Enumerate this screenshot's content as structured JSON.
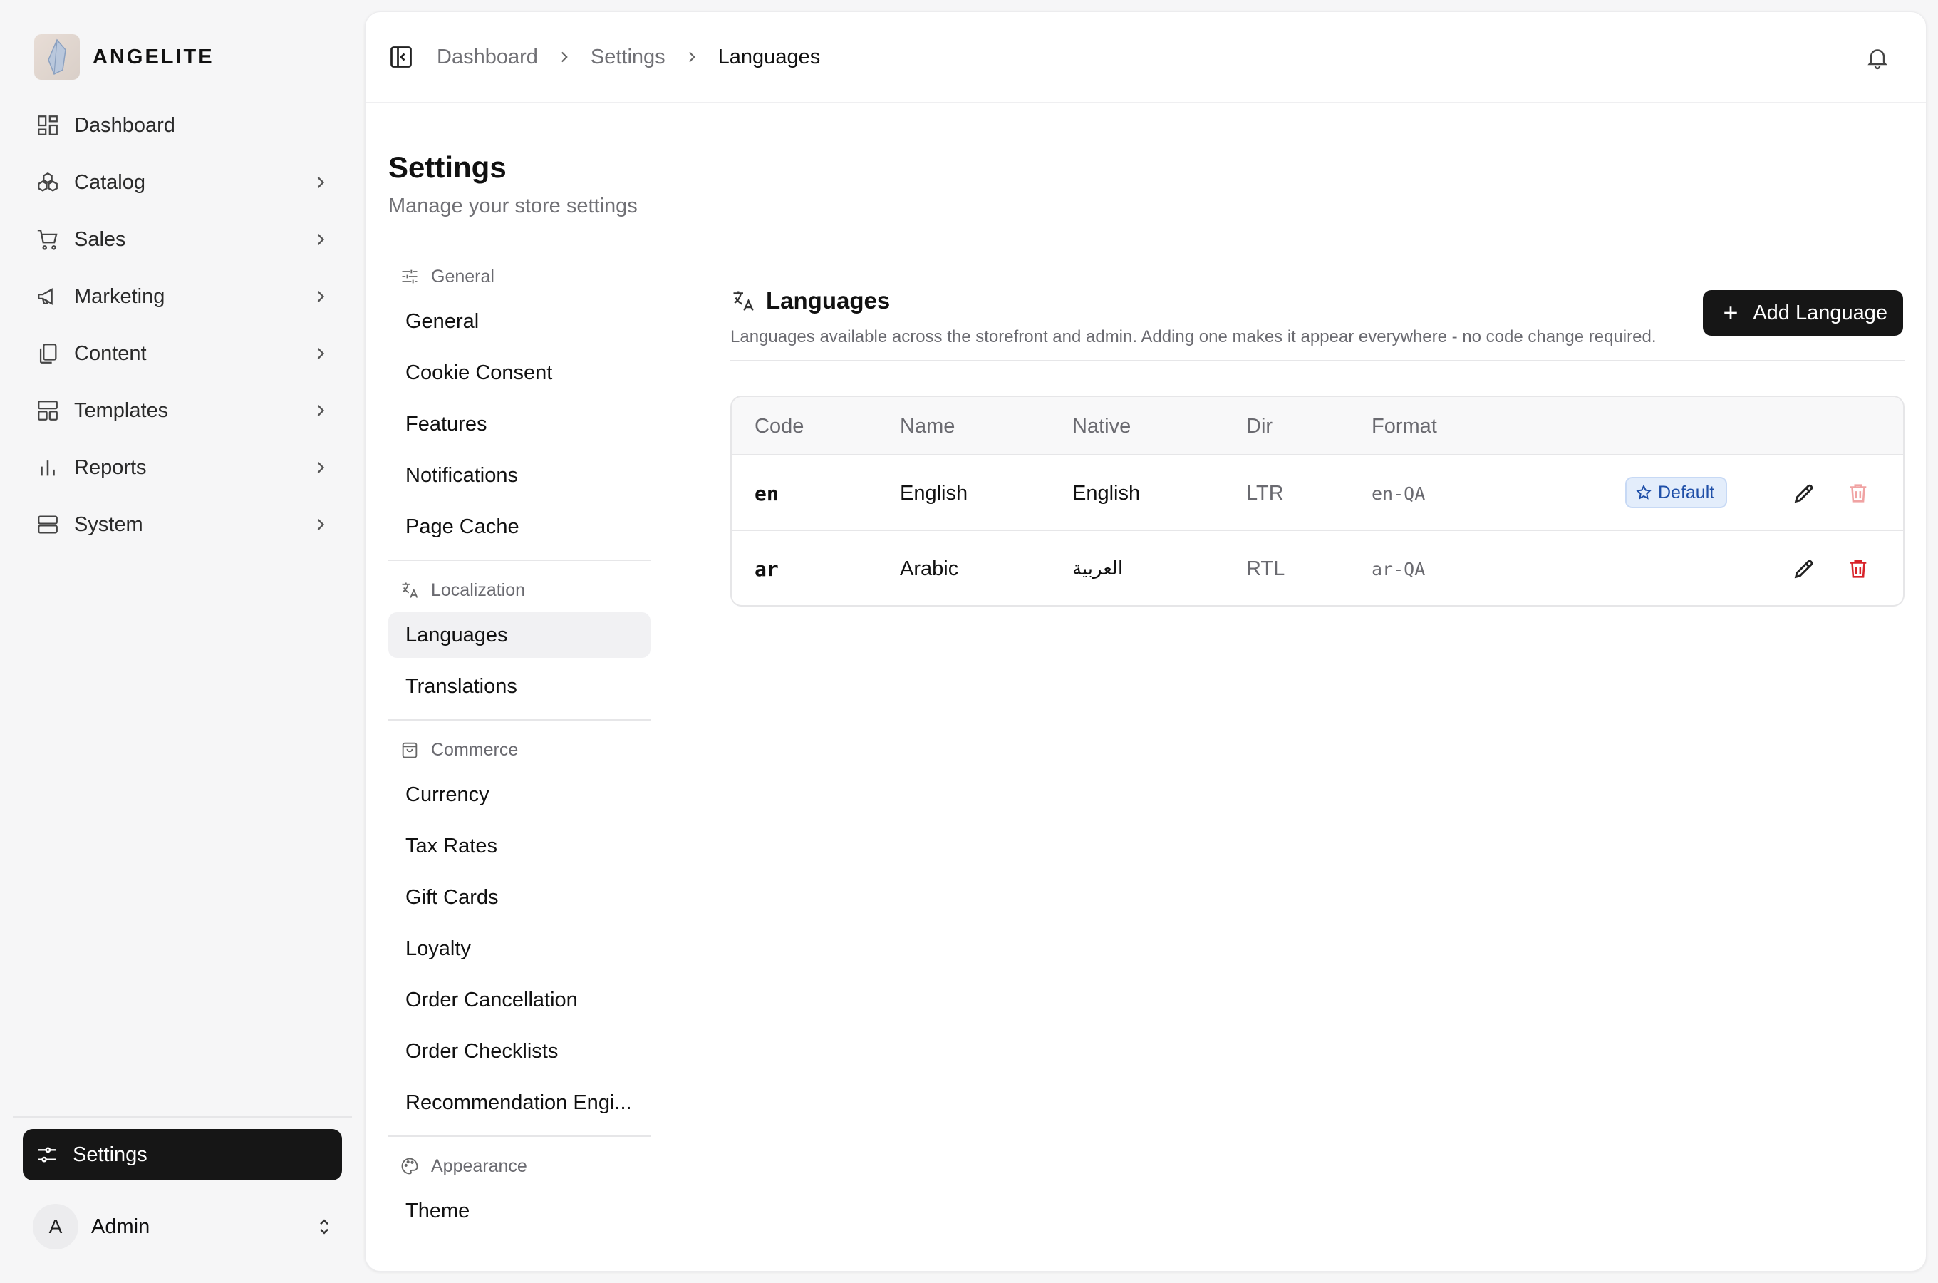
{
  "brand": {
    "name": "ANGELITE"
  },
  "sidebar": {
    "items": [
      {
        "label": "Dashboard",
        "icon": "dashboard-icon",
        "has_children": false
      },
      {
        "label": "Catalog",
        "icon": "catalog-icon",
        "has_children": true
      },
      {
        "label": "Sales",
        "icon": "cart-icon",
        "has_children": true
      },
      {
        "label": "Marketing",
        "icon": "megaphone-icon",
        "has_children": true
      },
      {
        "label": "Content",
        "icon": "documents-icon",
        "has_children": true
      },
      {
        "label": "Templates",
        "icon": "layout-icon",
        "has_children": true
      },
      {
        "label": "Reports",
        "icon": "bar-chart-icon",
        "has_children": true
      },
      {
        "label": "System",
        "icon": "server-icon",
        "has_children": true
      }
    ],
    "active_item": {
      "label": "Settings",
      "icon": "sliders-icon"
    },
    "user": {
      "initial": "A",
      "name": "Admin"
    }
  },
  "breadcrumb": [
    "Dashboard",
    "Settings",
    "Languages"
  ],
  "page": {
    "title": "Settings",
    "subtitle": "Manage your store settings"
  },
  "settings_nav": {
    "groups": [
      {
        "label": "General",
        "icon": "sliders-icon",
        "items": [
          "General",
          "Cookie Consent",
          "Features",
          "Notifications",
          "Page Cache"
        ]
      },
      {
        "label": "Localization",
        "icon": "translate-icon",
        "items": [
          "Languages",
          "Translations"
        ]
      },
      {
        "label": "Commerce",
        "icon": "shopping-bag-icon",
        "items": [
          "Currency",
          "Tax Rates",
          "Gift Cards",
          "Loyalty",
          "Order Cancellation",
          "Order Checklists",
          "Recommendation Engi..."
        ]
      },
      {
        "label": "Appearance",
        "icon": "palette-icon",
        "items": [
          "Theme"
        ]
      }
    ],
    "active": "Languages"
  },
  "languages": {
    "title": "Languages",
    "description": "Languages available across the storefront and admin. Adding one makes it appear everywhere - no code change required.",
    "add_button": "Add Language",
    "columns": [
      "Code",
      "Name",
      "Native",
      "Dir",
      "Format"
    ],
    "rows": [
      {
        "code": "en",
        "name": "English",
        "native": "English",
        "dir": "LTR",
        "format": "en-QA",
        "badge": "Default"
      },
      {
        "code": "ar",
        "name": "Arabic",
        "native": "العربية",
        "dir": "RTL",
        "format": "ar-QA",
        "badge": ""
      }
    ]
  },
  "colors": {
    "accent_dark": "#161616",
    "badge_bg": "#e3edfb",
    "badge_text": "#1f4fa8",
    "danger": "#d8232a"
  }
}
